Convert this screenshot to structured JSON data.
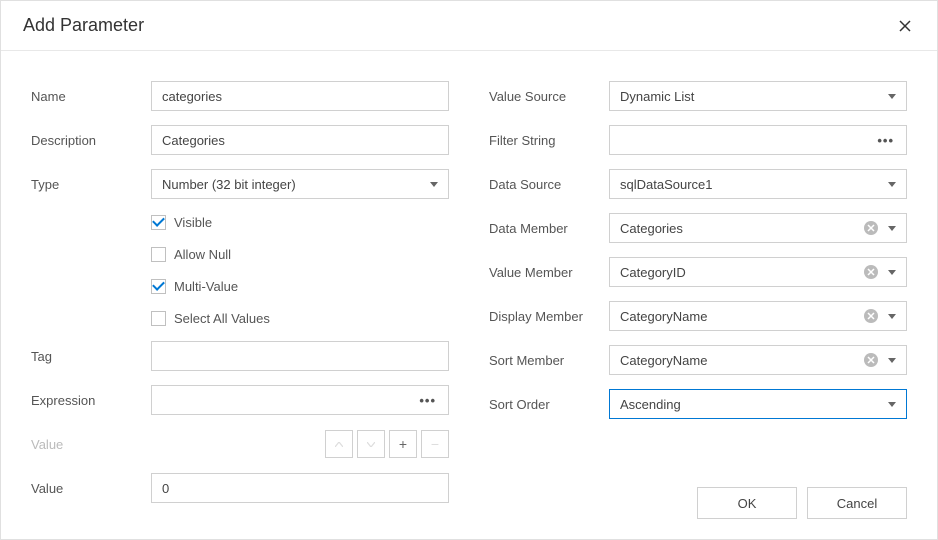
{
  "dialog": {
    "title": "Add Parameter"
  },
  "left": {
    "name_label": "Name",
    "name_value": "categories",
    "description_label": "Description",
    "description_value": "Categories",
    "type_label": "Type",
    "type_value": "Number (32 bit integer)",
    "cb_visible": "Visible",
    "cb_allow_null": "Allow Null",
    "cb_multi_value": "Multi-Value",
    "cb_select_all": "Select All Values",
    "tag_label": "Tag",
    "tag_value": "",
    "expression_label": "Expression",
    "expression_value": "",
    "value_disabled_label": "Value",
    "value_label": "Value",
    "value_value": "0"
  },
  "right": {
    "value_source_label": "Value Source",
    "value_source_value": "Dynamic List",
    "filter_string_label": "Filter String",
    "filter_string_value": "",
    "data_source_label": "Data Source",
    "data_source_value": "sqlDataSource1",
    "data_member_label": "Data Member",
    "data_member_value": "Categories",
    "value_member_label": "Value Member",
    "value_member_value": "CategoryID",
    "display_member_label": "Display Member",
    "display_member_value": "CategoryName",
    "sort_member_label": "Sort Member",
    "sort_member_value": "CategoryName",
    "sort_order_label": "Sort Order",
    "sort_order_value": "Ascending"
  },
  "footer": {
    "ok": "OK",
    "cancel": "Cancel"
  }
}
